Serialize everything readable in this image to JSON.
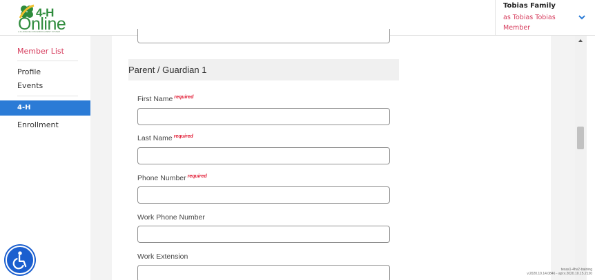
{
  "logo": {
    "top_text": "4-H",
    "main_text": "Online",
    "sub_text": "A 4-HONLINE.COM ENROLLMENT SYSTEM",
    "colors": {
      "brand": "#2e8b3c"
    }
  },
  "user": {
    "family": "Tobias Family",
    "as_text": "as Tobias Tobias",
    "role": "Member",
    "chevron_icon": "chevron-down-icon"
  },
  "sidebar": {
    "items": [
      {
        "label": "Member List"
      },
      {
        "label": "Profile"
      },
      {
        "label": "Events"
      },
      {
        "label": "4-H"
      },
      {
        "label": "Enrollment"
      }
    ],
    "accessibility_icon": "accessibility-icon"
  },
  "form": {
    "section_title": "Parent / Guardian 1",
    "required_text": "required",
    "fields": [
      {
        "label": "First Name",
        "required": true,
        "value": ""
      },
      {
        "label": "Last Name",
        "required": true,
        "value": ""
      },
      {
        "label": "Phone Number",
        "required": true,
        "value": ""
      },
      {
        "label": "Work Phone Number",
        "required": false,
        "value": ""
      },
      {
        "label": "Work Extension",
        "required": false,
        "value": ""
      }
    ]
  },
  "footer": {
    "version_line1": "texas1-4hv2-training",
    "version_line2": "v.2020.10.14.0846 - api:v.2020.10.15.2120"
  },
  "colors": {
    "accent": "#2b7bd6",
    "link": "#d63a5b",
    "required": "#e0112b"
  }
}
